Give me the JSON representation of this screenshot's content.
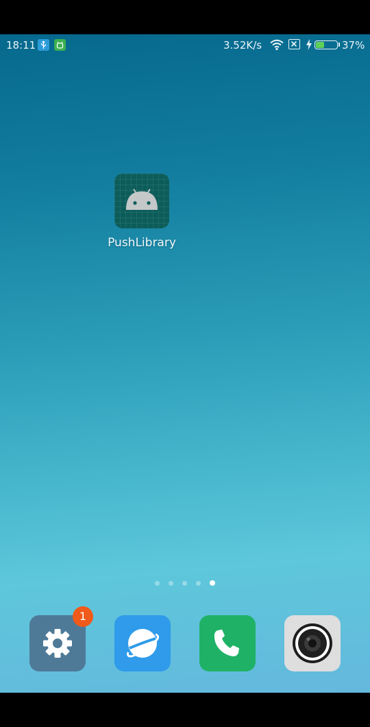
{
  "status_bar": {
    "time": "18:11",
    "network_speed": "3.52K/s",
    "battery_percent": "37%",
    "battery_level": 0.37,
    "notification_icons": [
      "usb-debug-icon",
      "android-debug-icon"
    ],
    "battery_color": "#5fd15a"
  },
  "home": {
    "apps": [
      {
        "label": "PushLibrary",
        "icon": "android-icon"
      }
    ]
  },
  "page_indicator": {
    "total_pages": 5,
    "active_page": 5
  },
  "dock": {
    "apps": [
      {
        "icon": "settings-gear-icon",
        "badge": "1"
      },
      {
        "icon": "browser-planet-icon"
      },
      {
        "icon": "phone-icon"
      },
      {
        "icon": "camera-lens-icon"
      }
    ]
  },
  "colors": {
    "badge": "#f05a1a",
    "settings_tile": "#4e7a97",
    "browser_tile": "#2f9bea",
    "phone_tile": "#1fb266",
    "camera_tile": "#dedede"
  }
}
